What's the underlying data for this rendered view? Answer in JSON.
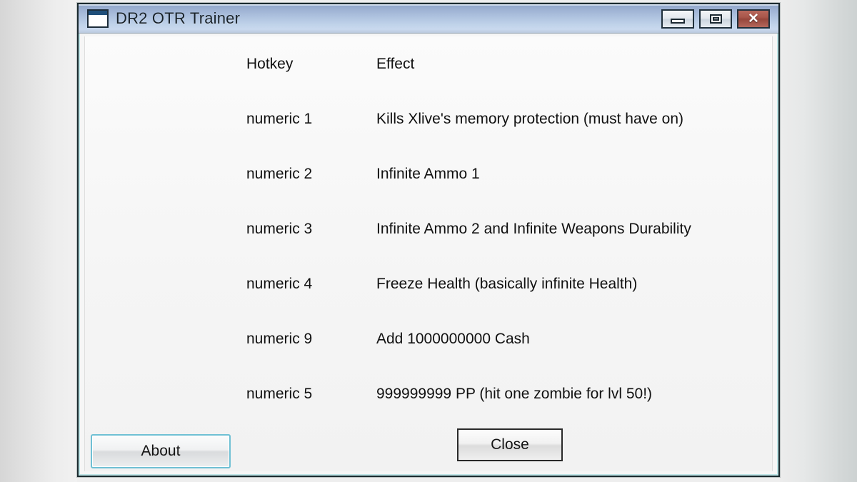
{
  "window": {
    "title": "DR2 OTR Trainer",
    "icon": "window-document-icon",
    "controls": {
      "minimize_label": "–",
      "maximize_label": "□",
      "close_label": "✕"
    }
  },
  "table": {
    "headers": {
      "hotkey": "Hotkey",
      "effect": "Effect"
    },
    "rows": [
      {
        "hotkey": "numeric 1",
        "effect": "Kills Xlive's memory protection (must have on)"
      },
      {
        "hotkey": "numeric 2",
        "effect": "Infinite Ammo 1"
      },
      {
        "hotkey": "numeric 3",
        "effect": "Infinite Ammo 2 and Infinite Weapons Durability"
      },
      {
        "hotkey": "numeric 4",
        "effect": "Freeze Health (basically infinite Health)"
      },
      {
        "hotkey": "numeric 9",
        "effect": "Add 1000000000 Cash"
      },
      {
        "hotkey": "numeric 5",
        "effect": "999999999 PP (hit one zombie for lvl 50!)"
      }
    ]
  },
  "footer": {
    "about_label": "About",
    "close_label": "Close"
  },
  "colors": {
    "titlebar_top": "#8fa5c9",
    "titlebar_bottom": "#c9d9ee",
    "close_button_red": "#a8564a",
    "about_focus_border": "#6fc0d4",
    "window_border": "#1b2a2e",
    "client_background": "#f6f6f6"
  }
}
